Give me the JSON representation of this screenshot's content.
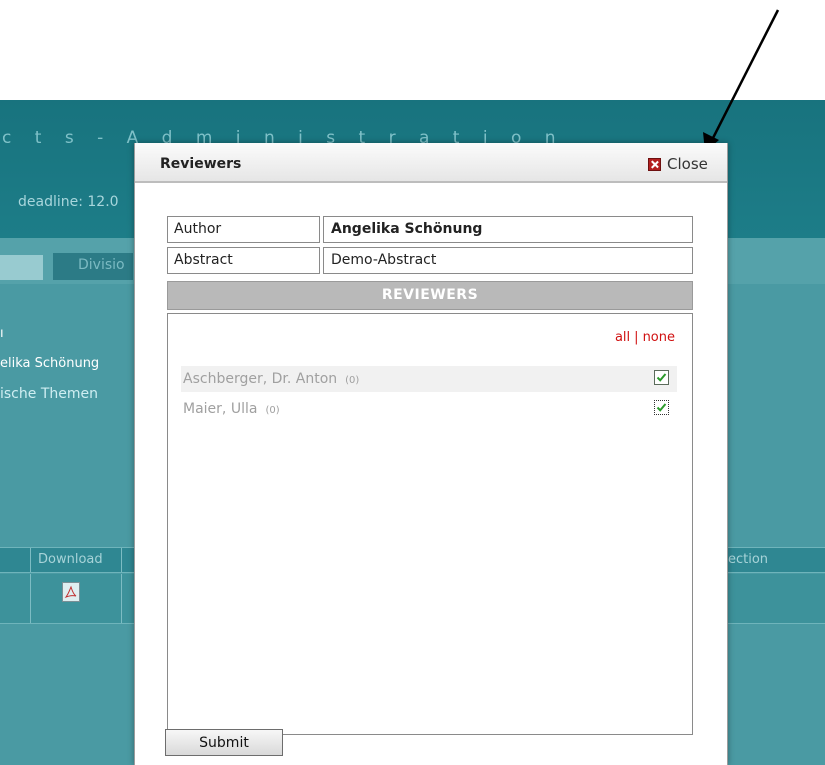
{
  "background": {
    "title": "c t s   -   A d m i n i s t r a t i o n",
    "deadline": "deadline: 12.0",
    "tab_label": "Divisio",
    "name_line": "elika Schönung",
    "topic_line": "ische Themen",
    "table_headers": [
      "Download",
      "ection"
    ]
  },
  "modal": {
    "title": "Reviewers",
    "close_label": "Close",
    "author_label": "Author",
    "author_value": "Angelika Schönung",
    "abstract_label": "Abstract",
    "abstract_value": "Demo-Abstract",
    "section_title": "REVIEWERS",
    "select_all": "all",
    "select_separator": "|",
    "select_none": "none",
    "reviewers": [
      {
        "name": "Aschberger, Dr. Anton",
        "count": "(0)",
        "checked": true
      },
      {
        "name": "Maier, Ulla",
        "count": "(0)",
        "checked": true
      }
    ],
    "submit_label": "Submit"
  },
  "colors": {
    "header_teal": "#18737e",
    "link_red": "#d01010",
    "check_green": "#2a9a2a"
  },
  "icons": [
    "close-icon",
    "checkbox-checked-icon",
    "pdf-icon",
    "arrow-annotation"
  ]
}
